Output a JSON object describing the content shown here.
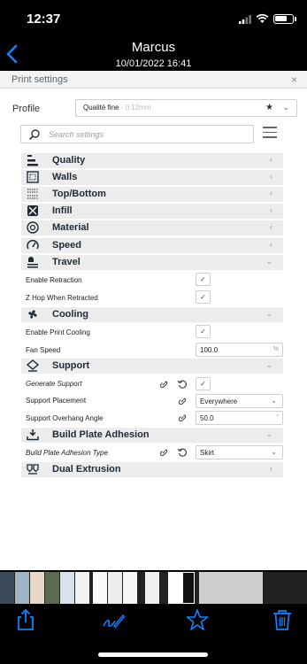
{
  "status": {
    "time": "12:37"
  },
  "nav": {
    "title": "Marcus",
    "subtitle": "10/01/2022 16:41"
  },
  "window": {
    "title": "Print settings",
    "close": "×"
  },
  "profile": {
    "label": "Profile",
    "value": "Qualité fine",
    "value_detail": " - 0.12mm"
  },
  "search": {
    "placeholder": "Search settings"
  },
  "categories": [
    {
      "label": "Quality",
      "icon": "quality-icon",
      "chevron": "‹"
    },
    {
      "label": "Walls",
      "icon": "walls-icon",
      "chevron": "‹"
    },
    {
      "label": "Top/Bottom",
      "icon": "top-bottom-icon",
      "chevron": "‹"
    },
    {
      "label": "Infill",
      "icon": "infill-icon",
      "chevron": "‹"
    },
    {
      "label": "Material",
      "icon": "material-icon",
      "chevron": "‹"
    },
    {
      "label": "Speed",
      "icon": "speed-icon",
      "chevron": "‹"
    },
    {
      "label": "Travel",
      "icon": "travel-icon",
      "chevron": "⌄"
    },
    {
      "label": "Cooling",
      "icon": "cooling-fan-icon",
      "chevron": "⌄"
    },
    {
      "label": "Support",
      "icon": "support-icon",
      "chevron": "⌄"
    },
    {
      "label": "Build Plate Adhesion",
      "icon": "build-plate-icon",
      "chevron": "⌄"
    },
    {
      "label": "Dual Extrusion",
      "icon": "dual-extrusion-icon",
      "chevron": "‹"
    }
  ],
  "settings": {
    "enable_retraction": {
      "label": "Enable Retraction",
      "check": "✓"
    },
    "z_hop": {
      "label": "Z Hop When Retracted",
      "check": "✓"
    },
    "enable_cooling": {
      "label": "Enable Print Cooling",
      "check": "✓"
    },
    "fan_speed": {
      "label": "Fan Speed",
      "value": "100.0",
      "unit": "%"
    },
    "generate_support": {
      "label": "Generate Support",
      "check": "✓"
    },
    "support_placement": {
      "label": "Support Placement",
      "value": "Everywhere",
      "dropdown": "⌄"
    },
    "overhang_angle": {
      "label": "Support Overhang Angle",
      "value": "50.0",
      "unit": "°"
    },
    "adhesion_type": {
      "label": "Build Plate Adhesion Type",
      "value": "Skirt",
      "dropdown": "⌄"
    }
  },
  "colors": {
    "accent": "#0a84ff",
    "category_bg": "#ececec",
    "dark_text": "#1f2a36"
  }
}
